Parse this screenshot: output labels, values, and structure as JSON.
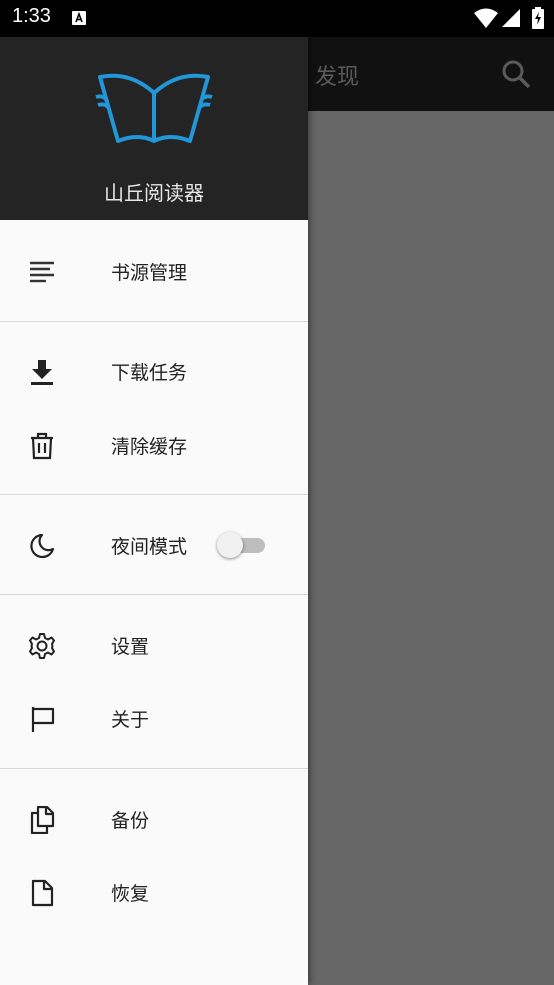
{
  "status_bar": {
    "time": "1:33"
  },
  "app_bar": {
    "title": "发现"
  },
  "drawer": {
    "app_name": "山丘阅读器",
    "sections": [
      {
        "items": [
          {
            "label": "书源管理",
            "icon": "list-icon"
          }
        ]
      },
      {
        "items": [
          {
            "label": "下载任务",
            "icon": "download-icon"
          },
          {
            "label": "清除缓存",
            "icon": "trash-icon"
          }
        ]
      },
      {
        "items": [
          {
            "label": "夜间模式",
            "icon": "moon-icon",
            "toggle": false
          }
        ]
      },
      {
        "items": [
          {
            "label": "设置",
            "icon": "settings-icon"
          },
          {
            "label": "关于",
            "icon": "flag-icon"
          }
        ]
      },
      {
        "items": [
          {
            "label": "备份",
            "icon": "copy-icon"
          },
          {
            "label": "恢复",
            "icon": "file-icon"
          }
        ]
      }
    ]
  },
  "colors": {
    "logo_blue": "#2196d8",
    "drawer_header": "#242424",
    "scrim": "#666666"
  }
}
